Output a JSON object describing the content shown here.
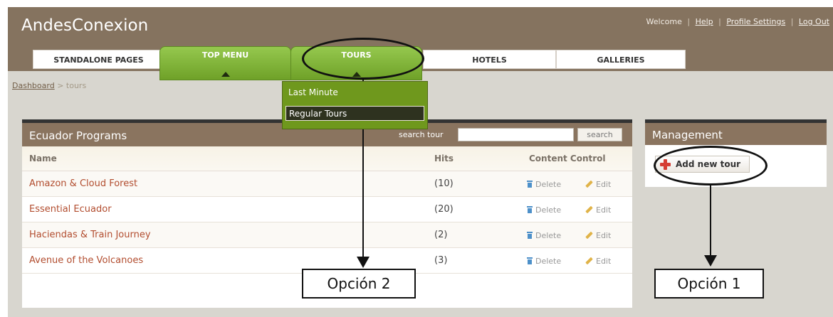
{
  "app": {
    "title": "AndesConexion"
  },
  "header": {
    "welcome": "Welcome",
    "links": [
      "Help",
      "Profile Settings",
      "Log Out"
    ]
  },
  "nav": {
    "tabs": [
      {
        "label": "STANDALONE PAGES",
        "active": false
      },
      {
        "label": "TOP MENU",
        "active": true
      },
      {
        "label": "TOURS",
        "active": true
      },
      {
        "label": "HOTELS",
        "active": false
      },
      {
        "label": "GALLERIES",
        "active": false
      }
    ]
  },
  "breadcrumb": {
    "root": "Dashboard",
    "separator": ">",
    "current": "tours"
  },
  "dropdown": {
    "items": [
      "Last Minute",
      "Regular Tours"
    ],
    "selected": "Regular Tours"
  },
  "programs": {
    "title": "Ecuador Programs",
    "search_label": "search tour",
    "search_value": "",
    "search_button": "search",
    "columns": {
      "name": "Name",
      "hits": "Hits",
      "control": "Content Control"
    },
    "rows": [
      {
        "name": "Amazon & Cloud Forest",
        "hits": "(10)",
        "delete": "Delete",
        "edit": "Edit"
      },
      {
        "name": "Essential Ecuador",
        "hits": "(20)",
        "delete": "Delete",
        "edit": "Edit"
      },
      {
        "name": "Haciendas & Train Journey",
        "hits": "(2)",
        "delete": "Delete",
        "edit": "Edit"
      },
      {
        "name": "Avenue of the Volcanoes",
        "hits": "(3)",
        "delete": "Delete",
        "edit": "Edit"
      }
    ]
  },
  "management": {
    "title": "Management",
    "add_button": "Add new tour"
  },
  "annotations": {
    "option_2": "Opción 2",
    "option_1": "Opción 1"
  },
  "icons": {
    "delete": "trash-icon",
    "edit": "pencil-icon",
    "add": "plus-icon"
  },
  "colors": {
    "header": "#85735f",
    "panel_header": "#8a745f",
    "green_tab": "#7fb43a",
    "dropdown": "#6f981d",
    "link_red": "#b24d2f"
  }
}
